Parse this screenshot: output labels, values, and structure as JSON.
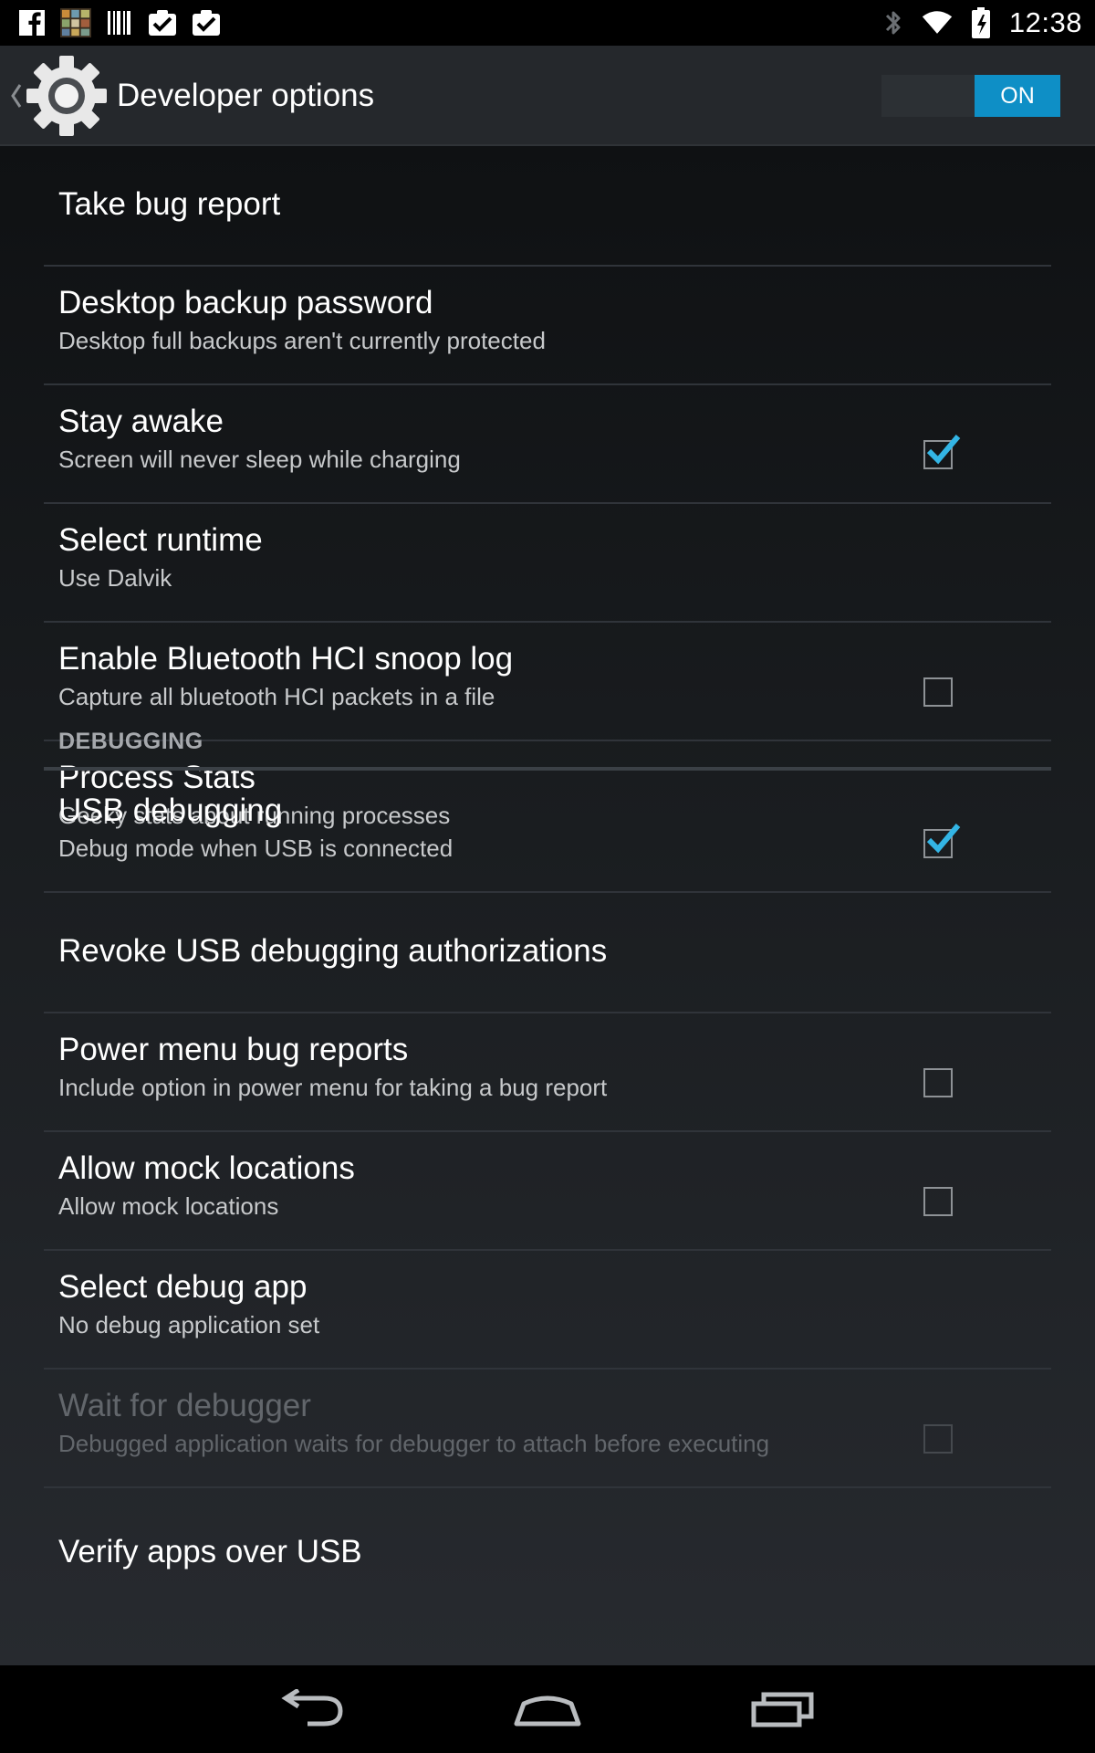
{
  "status_bar": {
    "time": "12:38",
    "left_icons": [
      "facebook-icon",
      "photo-gallery-icon",
      "barcode-icon",
      "task-check-icon",
      "task-check-icon"
    ],
    "right_icons": [
      "bluetooth-icon",
      "wifi-icon",
      "battery-icon"
    ]
  },
  "action_bar": {
    "title": "Developer options",
    "icon": "settings-gear-icon",
    "master_switch": {
      "label": "ON",
      "on": true,
      "accent": "#0e8fc6"
    }
  },
  "items": [
    {
      "title": "Take bug report",
      "subtitle": "",
      "checkbox": null,
      "enabled": true
    },
    {
      "title": "Desktop backup password",
      "subtitle": "Desktop full backups aren't currently protected",
      "checkbox": null,
      "enabled": true
    },
    {
      "title": "Stay awake",
      "subtitle": "Screen will never sleep while charging",
      "checkbox": true,
      "enabled": true
    },
    {
      "title": "Select runtime",
      "subtitle": "Use Dalvik",
      "checkbox": null,
      "enabled": true
    },
    {
      "title": "Enable Bluetooth HCI snoop log",
      "subtitle": "Capture all bluetooth HCI packets in a file",
      "checkbox": false,
      "enabled": true
    },
    {
      "title": "Process Stats",
      "subtitle": "Geeky stats about running processes",
      "checkbox": null,
      "enabled": true
    }
  ],
  "section_header": "DEBUGGING",
  "debug_items": [
    {
      "title": "USB debugging",
      "subtitle": "Debug mode when USB is connected",
      "checkbox": true,
      "enabled": true
    },
    {
      "title": "Revoke USB debugging authorizations",
      "subtitle": "",
      "checkbox": null,
      "enabled": true
    },
    {
      "title": "Power menu bug reports",
      "subtitle": "Include option in power menu for taking a bug report",
      "checkbox": false,
      "enabled": true
    },
    {
      "title": "Allow mock locations",
      "subtitle": "Allow mock locations",
      "checkbox": false,
      "enabled": true
    },
    {
      "title": "Select debug app",
      "subtitle": "No debug application set",
      "checkbox": null,
      "enabled": true
    },
    {
      "title": "Wait for debugger",
      "subtitle": "Debugged application waits for debugger to attach before executing",
      "checkbox": false,
      "enabled": false
    },
    {
      "title": "Verify apps over USB",
      "subtitle": "",
      "checkbox": null,
      "enabled": true
    }
  ],
  "nav_bar": {
    "buttons": [
      "back-icon",
      "home-icon",
      "recent-apps-icon"
    ]
  },
  "colors": {
    "accent": "#33b5e5",
    "switch_on": "#0e8fc6",
    "action_bar": "#25282c"
  }
}
